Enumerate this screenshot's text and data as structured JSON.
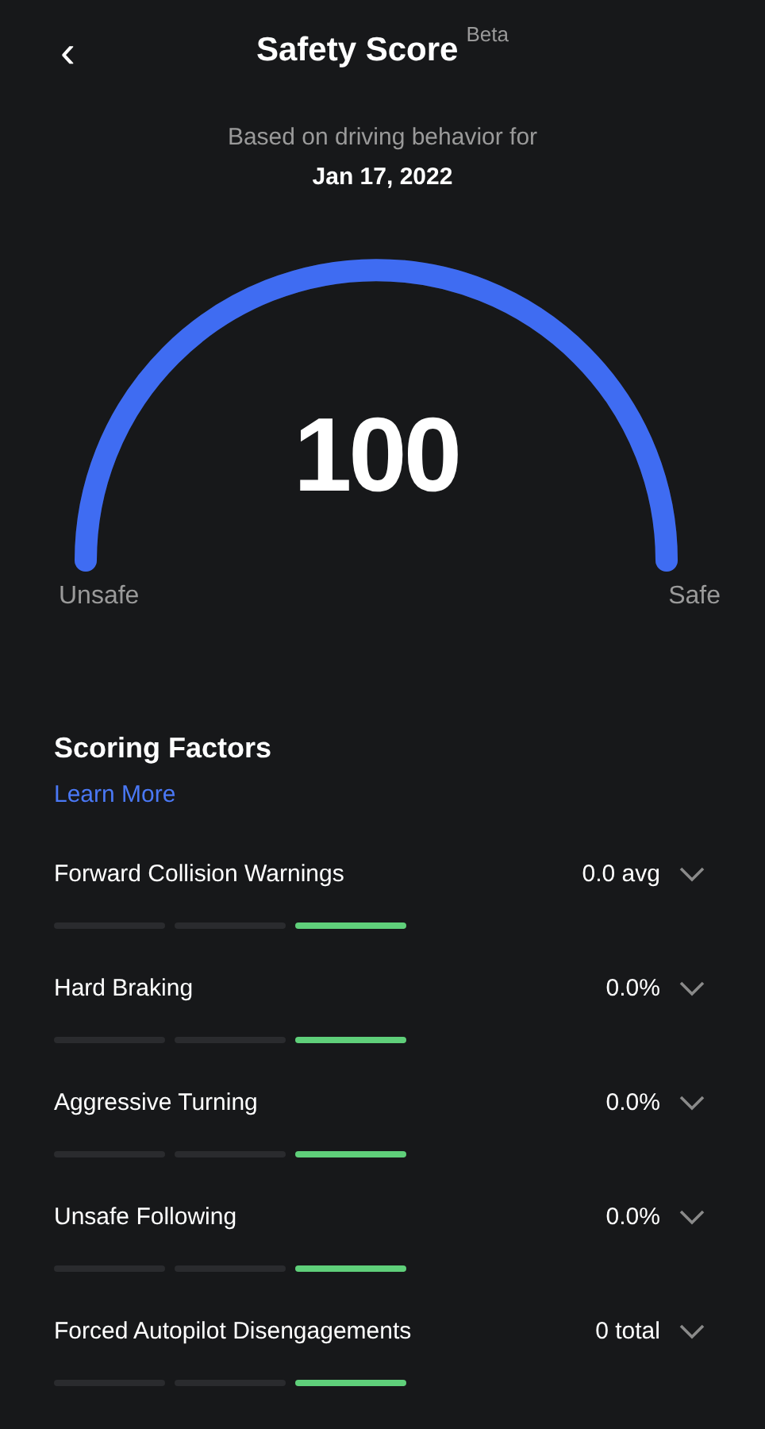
{
  "header": {
    "back": "‹",
    "title": "Safety Score",
    "tag": "Beta"
  },
  "subtitle": "Based on driving behavior for",
  "date": "Jan 17, 2022",
  "gauge": {
    "score": "100",
    "level": 1.0,
    "min_label": "Unsafe",
    "max_label": "Safe"
  },
  "factors_title": "Scoring Factors",
  "learn_more": "Learn More",
  "factors": [
    {
      "name": "Forward Collision Warnings",
      "value": "0.0 avg",
      "expanded": false,
      "segments": [
        {
          "selected": false
        },
        {
          "selected": false
        },
        {
          "selected": true
        }
      ]
    },
    {
      "name": "Hard Braking",
      "value": "0.0%",
      "expanded": false,
      "segments": [
        {
          "selected": false
        },
        {
          "selected": false
        },
        {
          "selected": true
        }
      ]
    },
    {
      "name": "Aggressive Turning",
      "value": "0.0%",
      "expanded": false,
      "segments": [
        {
          "selected": false
        },
        {
          "selected": false
        },
        {
          "selected": true
        }
      ]
    },
    {
      "name": "Unsafe Following",
      "value": "0.0%",
      "expanded": false,
      "segments": [
        {
          "selected": false
        },
        {
          "selected": false
        },
        {
          "selected": true
        }
      ]
    },
    {
      "name": "Forced Autopilot Disengagements",
      "value": "0 total",
      "expanded": false,
      "segments": [
        {
          "selected": false
        },
        {
          "selected": false
        },
        {
          "selected": true
        }
      ]
    }
  ]
}
